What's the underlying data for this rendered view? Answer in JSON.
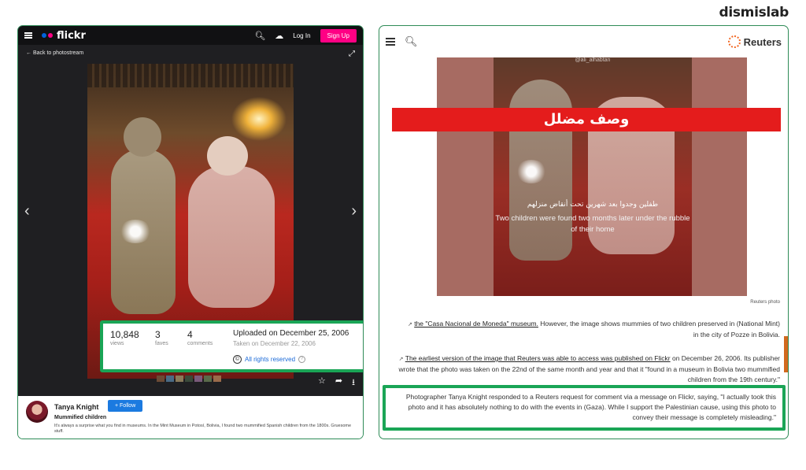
{
  "brand": "dismislab",
  "flickr": {
    "logo": "flickr",
    "login": "Log In",
    "signup": "Sign Up",
    "back": "Back to photostream",
    "stats": {
      "views": "10,848",
      "views_label": "views",
      "faves": "3",
      "faves_label": "faves",
      "comments": "4",
      "comments_label": "comments"
    },
    "uploaded": "Uploaded on December 25, 2006",
    "taken": "Taken on December 22, 2006",
    "rights": "All rights reserved",
    "author": "Tanya Knight",
    "follow": "+ Follow",
    "photo_title": "Mummified children",
    "description": "It's always a surprise what you find in museums. In the Mint Museum in Potosí, Bolivia, I found two mummified Spanish children from the 1800s. Gruesome stuff.",
    "colors": {
      "signup": "#ff0084",
      "follow": "#1b7ae0",
      "highlight": "#1aa556"
    }
  },
  "reuters": {
    "logo": "Reuters",
    "image_handle": "@ali_alhabtan",
    "banner": "وصف مضلل",
    "arabic_caption": "طفلين وجدوا بعد شهرين تحت أنقاض منزلهم",
    "english_caption": "Two children were found two months later under the rubble of their home",
    "credit": "Reuters photo",
    "p1_link": "the \"Casa Nacional de Moneda\" museum.",
    "p1_rest": " However, the image shows mummies of two children preserved in (National Mint) in the city of Pozze in Bolivia.",
    "p2_link": "The earliest version of the image that Reuters was able to access was published on Flickr",
    "p2_rest": " on December 26, 2006. Its publisher wrote that the photo was taken on the 22nd of the same month and year and that it \"found in a museum in Bolivia two mummified children from the 19th century.\"",
    "quote": "Photographer Tanya Knight responded to a Reuters request for comment via a message on Flickr, saying, \"I actually took this photo and it has absolutely nothing to do with the events in (Gaza). While I support the Palestinian cause, using this photo to convey their message is completely misleading.\""
  }
}
